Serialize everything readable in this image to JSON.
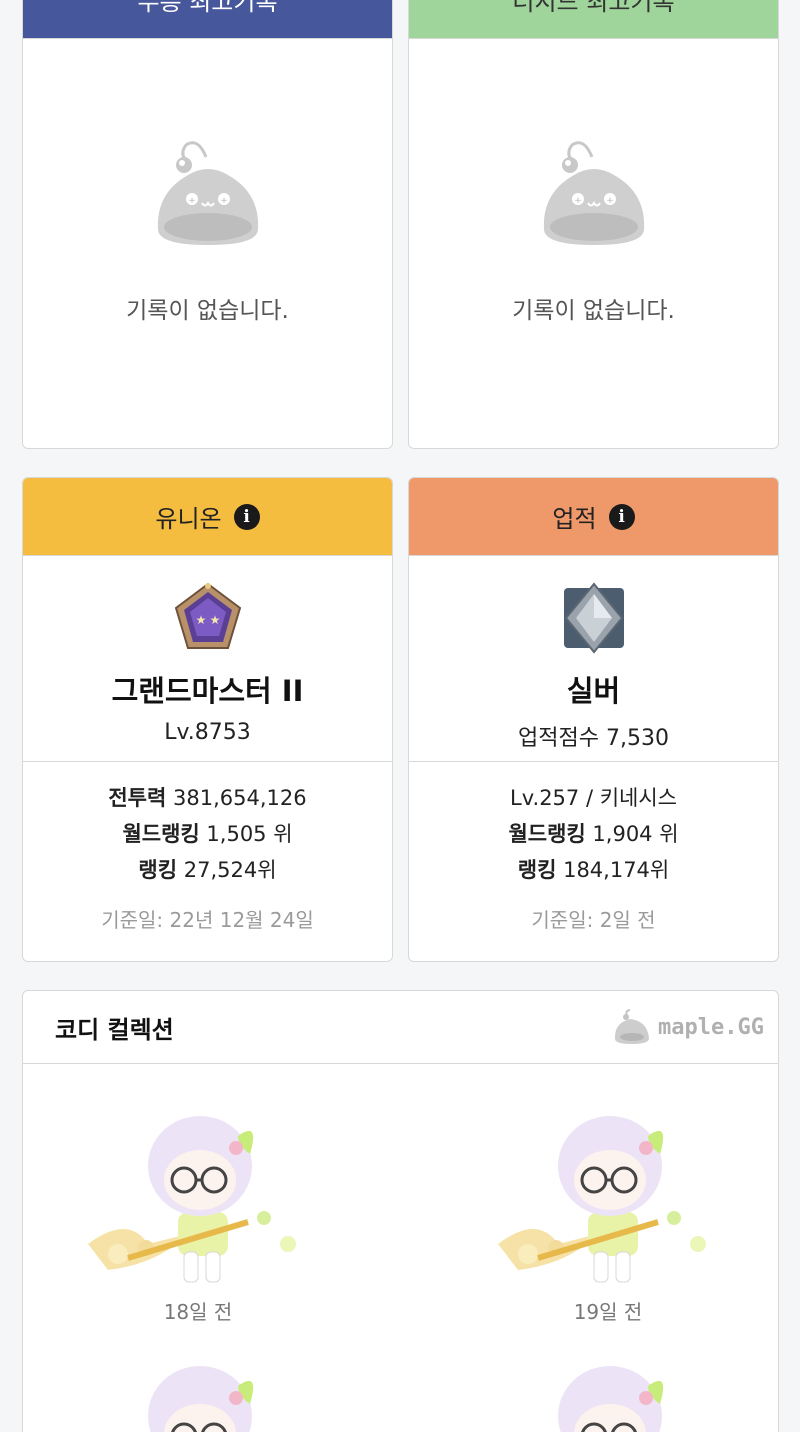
{
  "records": {
    "mureung": {
      "title": "무릉 최고기록",
      "empty_text": "기록이 없습니다."
    },
    "theseed": {
      "title": "더시드 최고기록",
      "empty_text": "기록이 없습니다."
    }
  },
  "union": {
    "title": "유니온",
    "grade": "그랜드마스터 II",
    "level": "Lv.8753",
    "power_label": "전투력",
    "power_value": "381,654,126",
    "world_rank_label": "월드랭킹",
    "world_rank_value": "1,505 위",
    "rank_label": "랭킹",
    "rank_value": "27,524위",
    "date": "기준일: 22년 12월 24일"
  },
  "achievement": {
    "title": "업적",
    "grade": "실버",
    "score": "업적점수 7,530",
    "level_world": "Lv.257 / 키네시스",
    "world_rank_label": "월드랭킹",
    "world_rank_value": "1,904 위",
    "rank_label": "랭킹",
    "rank_value": "184,174위",
    "date": "기준일: 2일 전"
  },
  "codi": {
    "title": "코디 컬렉션",
    "brand": "maple.GG",
    "items": [
      {
        "label": "18일 전"
      },
      {
        "label": "19일 전"
      },
      {
        "label": ""
      },
      {
        "label": ""
      }
    ]
  },
  "colors": {
    "mureung_header": "#46579c",
    "theseed_header": "#9fd59b",
    "union_header": "#f4bd40",
    "achievement_header": "#ef996b"
  }
}
